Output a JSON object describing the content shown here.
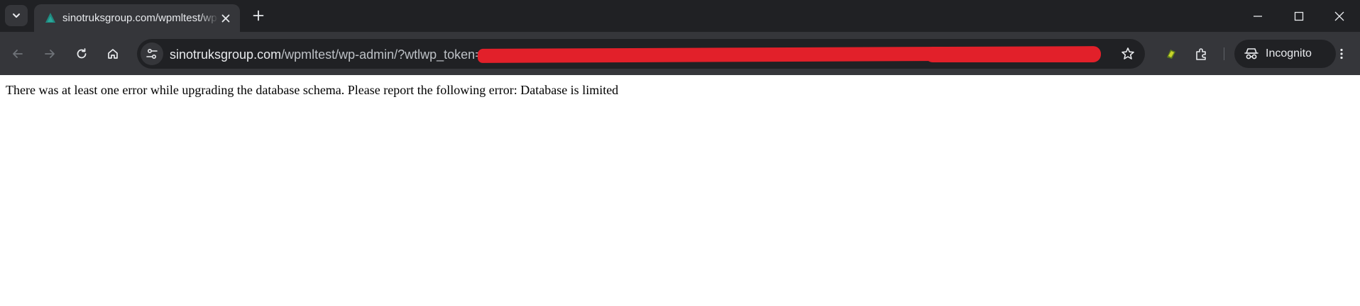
{
  "browser": {
    "tab": {
      "title": "sinotruksgroup.com/wpmltest/wp-admin/?wtlwp_token=",
      "favicon": "wordpress-favicon-icon"
    },
    "address_bar": {
      "host": "sinotruksgroup.com",
      "path": "/wpmltest/wp-admin/?wtlwp_token="
    },
    "profile": {
      "label": "Incognito"
    },
    "icons": {
      "tab_search": "chevron-down-icon",
      "tab_close": "close-icon",
      "new_tab": "plus-icon",
      "minimize": "minimize-icon",
      "maximize": "maximize-icon",
      "close_window": "close-icon",
      "back": "arrow-left-icon",
      "forward": "arrow-right-icon",
      "reload": "reload-icon",
      "home": "home-icon",
      "site_info": "tune-icon",
      "bookmark": "star-icon",
      "extension": "extension-leaf-icon",
      "extensions_menu": "puzzle-icon",
      "menu": "kebab-menu-icon"
    },
    "colors": {
      "tabstrip": "#202124",
      "toolbar": "#35363a",
      "omnibox": "#202124",
      "redaction": "#e2202a",
      "text_light": "#e8eaed"
    }
  },
  "page": {
    "error_message": "There was at least one error while upgrading the database schema. Please report the following error: Database is limited"
  }
}
